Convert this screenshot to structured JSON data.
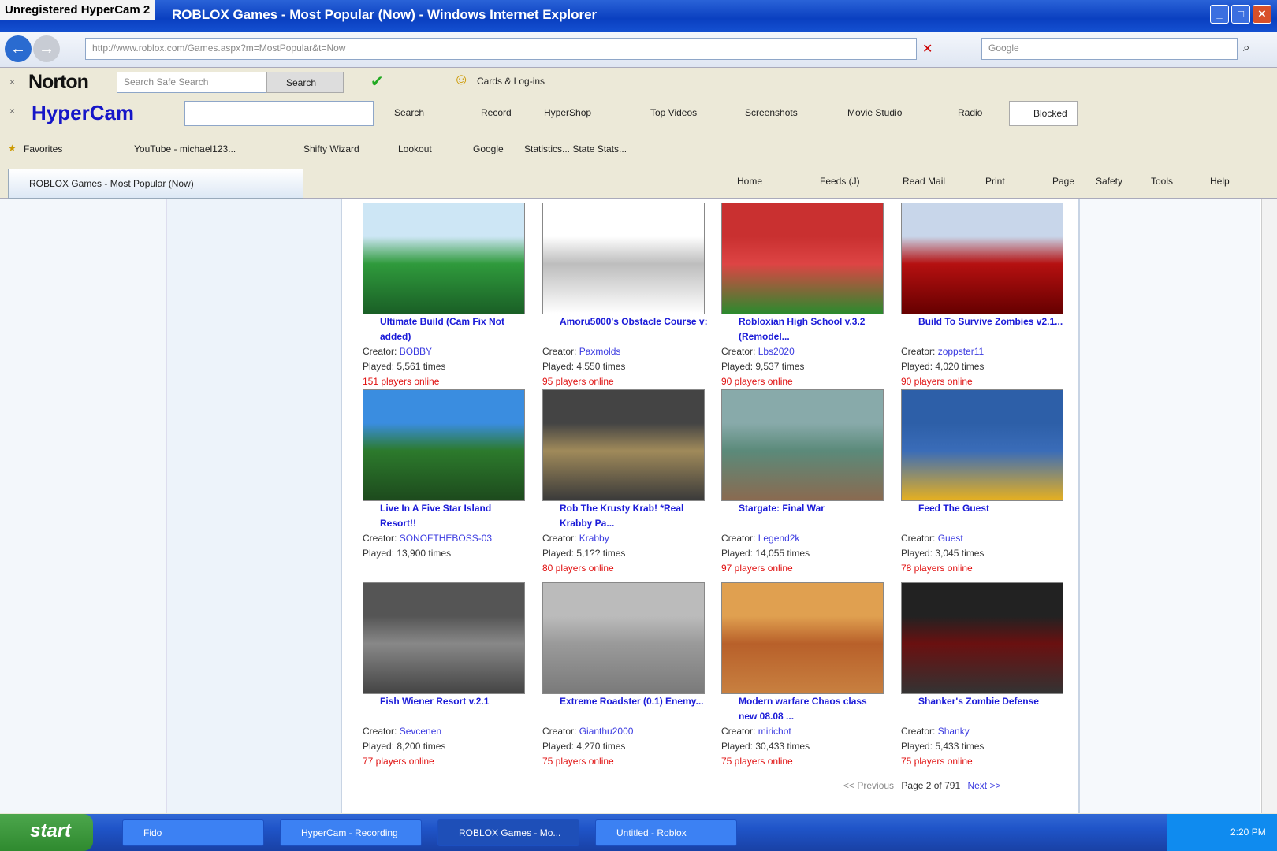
{
  "window": {
    "recorder_label": "Unregistered HyperCam 2",
    "title": "ROBLOX Games - Most Popular (Now) - Windows Internet Explorer"
  },
  "address": {
    "url": "http://www.roblox.com/Games.aspx?m=MostPopular&t=Now",
    "search_placeholder": "Google"
  },
  "norton": {
    "brand": "Norton",
    "search_placeholder": "Search Safe Search",
    "search_button": "Search",
    "cards_label": "Cards & Log-ins"
  },
  "hypercam": {
    "brand": "HyperCam",
    "items": [
      "Search",
      "Record",
      "HyperShop",
      "Top Videos",
      "Screenshots",
      "Movie Studio",
      "Radio",
      "Blocked"
    ]
  },
  "favorites": {
    "label": "Favorites",
    "items": [
      "YouTube - michael123...",
      "Shifty Wizard",
      "Lookout",
      "Google",
      "Statistics... State Stats..."
    ]
  },
  "tab": {
    "label": "ROBLOX Games - Most Popular (Now)"
  },
  "command_bar": [
    "Home",
    "Feeds (J)",
    "Read Mail",
    "Print",
    "Page",
    "Safety",
    "Tools",
    "Help"
  ],
  "games": [
    {
      "name": "Ultimate Build (Cam Fix Not added)",
      "creator": "BOBBY",
      "played": "5,561 times",
      "online": "151 players online",
      "thumb": [
        "#cde6f5",
        "#2f9a3c",
        "#1a5f26"
      ]
    },
    {
      "name": "Amoru5000's Obstacle Course v:",
      "creator": "Paxmolds",
      "played": "4,550 times",
      "online": "95 players online",
      "thumb": [
        "#ffffff",
        "#bdbdbd",
        "#ffffff"
      ]
    },
    {
      "name": "Robloxian High School v.3.2 (Remodel...",
      "creator": "Lbs2020",
      "played": "9,537 times",
      "online": "90 players online",
      "thumb": [
        "#c93030",
        "#d44",
        "#2b8a2e"
      ]
    },
    {
      "name": "Build To Survive Zombies v2.1...",
      "creator": "zoppster11",
      "played": "4,020 times",
      "online": "90 players online",
      "thumb": [
        "#c8d6ea",
        "#b51010",
        "#600"
      ]
    },
    {
      "name": "Live In A Five Star Island Resort!!",
      "creator": "SONOFTHEBOSS-03",
      "played": "13,900 times",
      "online": "",
      "thumb": [
        "#3a8de0",
        "#2c7a2c",
        "#1d4a1d"
      ]
    },
    {
      "name": "Rob The Krusty Krab! *Real Krabby Pa...",
      "creator": "Krabby",
      "played": "5,1?? times",
      "online": "80 players online",
      "thumb": [
        "#444",
        "#a08a5a",
        "#3a3a3a"
      ]
    },
    {
      "name": "Stargate: Final War",
      "creator": "Legend2k",
      "played": "14,055 times",
      "online": "97 players online",
      "thumb": [
        "#8aa",
        "#5b8a7a",
        "#8a6a50"
      ]
    },
    {
      "name": "Feed The Guest",
      "creator": "Guest",
      "played": "3,045 times",
      "online": "78 players online",
      "thumb": [
        "#2d5fa8",
        "#3a6cb8",
        "#e6b020"
      ]
    },
    {
      "name": "Fish Wiener Resort v.2.1",
      "creator": "Sevcenen",
      "played": "8,200 times",
      "online": "77 players online",
      "thumb": [
        "#555",
        "#888",
        "#444"
      ]
    },
    {
      "name": "Extreme Roadster (0.1) Enemy...",
      "creator": "Gianthu2000",
      "played": "4,270 times",
      "online": "75 players online",
      "thumb": [
        "#bbb",
        "#9a9a9a",
        "#7a7a7a"
      ]
    },
    {
      "name": "Modern warfare Chaos class new 08.08 ...",
      "creator": "mirichot",
      "played": "30,433 times",
      "online": "75 players online",
      "thumb": [
        "#e0a050",
        "#b8602a",
        "#c88040"
      ]
    },
    {
      "name": "Shanker's Zombie Defense",
      "creator": "Shanky",
      "played": "5,433 times",
      "online": "75 players online",
      "thumb": [
        "#222",
        "#6a1010",
        "#333"
      ]
    }
  ],
  "labels": {
    "creator": "Creator:",
    "played": "Played:"
  },
  "pager": {
    "prev": "<< Previous",
    "text": "Page 2 of 791",
    "next": "Next >>"
  },
  "taskbar": {
    "start": "start",
    "tasks": [
      "Fido",
      "HyperCam - Recording",
      "ROBLOX Games - Mo...",
      "Untitled - Roblox"
    ],
    "clock": "2:20 PM"
  }
}
